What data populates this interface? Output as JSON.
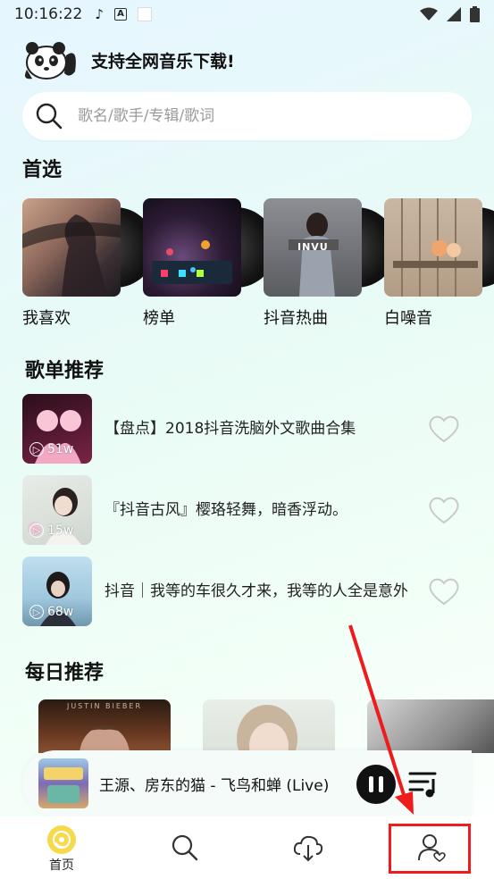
{
  "status_bar": {
    "time": "10:16:22",
    "icons": [
      "music-note-icon",
      "a-box-icon",
      "white-square-icon",
      "wifi-icon",
      "signal-icon",
      "battery-icon"
    ]
  },
  "brand": {
    "slogan": "支持全网音乐下载!"
  },
  "search": {
    "placeholder": "歌名/歌手/专辑/歌词"
  },
  "featured": {
    "title": "首选",
    "items": [
      {
        "label": "我喜欢"
      },
      {
        "label": "榜单"
      },
      {
        "label": "抖音热曲",
        "cover_text": "INVU"
      },
      {
        "label": "白噪音"
      }
    ]
  },
  "playlists": {
    "title": "歌单推荐",
    "items": [
      {
        "title": "【盘点】2018抖音洗脑外文歌曲合集",
        "play_count": "51w"
      },
      {
        "title": "『抖音古风』樱珞轻舞，暗香浮动。",
        "play_count": "15w"
      },
      {
        "title": "抖音｜我等的车很久才来，我等的人全是意外",
        "play_count": "68w"
      }
    ]
  },
  "daily": {
    "title": "每日推荐",
    "cover_text": "JUSTIN BIEBER"
  },
  "player": {
    "song": "王源、房东的猫 - 飞鸟和蝉 (Live)"
  },
  "tabbar": {
    "items": [
      {
        "label": "首页",
        "icon": "home-disc-icon",
        "active": true
      },
      {
        "label": "",
        "icon": "search-icon"
      },
      {
        "label": "",
        "icon": "cloud-download-icon"
      },
      {
        "label": "",
        "icon": "user-heart-icon"
      }
    ]
  },
  "colors": {
    "accent_yellow": "#f7d94c",
    "annotation_red": "#ee1c1c"
  }
}
